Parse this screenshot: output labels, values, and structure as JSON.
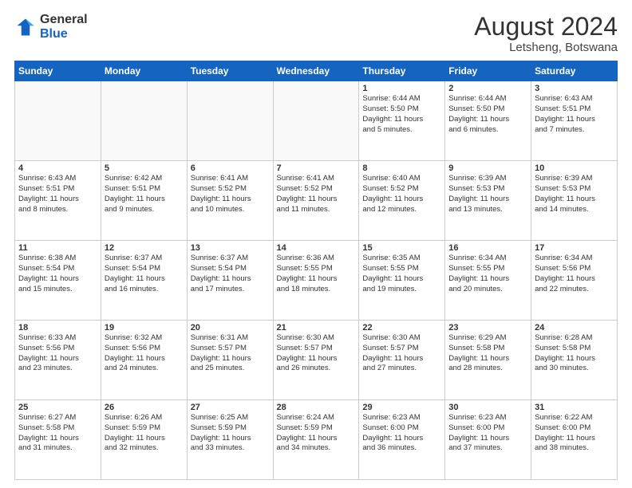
{
  "logo": {
    "general": "General",
    "blue": "Blue"
  },
  "header": {
    "month_year": "August 2024",
    "location": "Letsheng, Botswana"
  },
  "days_of_week": [
    "Sunday",
    "Monday",
    "Tuesday",
    "Wednesday",
    "Thursday",
    "Friday",
    "Saturday"
  ],
  "weeks": [
    [
      {
        "num": "",
        "detail": ""
      },
      {
        "num": "",
        "detail": ""
      },
      {
        "num": "",
        "detail": ""
      },
      {
        "num": "",
        "detail": ""
      },
      {
        "num": "1",
        "detail": "Sunrise: 6:44 AM\nSunset: 5:50 PM\nDaylight: 11 hours\nand 5 minutes."
      },
      {
        "num": "2",
        "detail": "Sunrise: 6:44 AM\nSunset: 5:50 PM\nDaylight: 11 hours\nand 6 minutes."
      },
      {
        "num": "3",
        "detail": "Sunrise: 6:43 AM\nSunset: 5:51 PM\nDaylight: 11 hours\nand 7 minutes."
      }
    ],
    [
      {
        "num": "4",
        "detail": "Sunrise: 6:43 AM\nSunset: 5:51 PM\nDaylight: 11 hours\nand 8 minutes."
      },
      {
        "num": "5",
        "detail": "Sunrise: 6:42 AM\nSunset: 5:51 PM\nDaylight: 11 hours\nand 9 minutes."
      },
      {
        "num": "6",
        "detail": "Sunrise: 6:41 AM\nSunset: 5:52 PM\nDaylight: 11 hours\nand 10 minutes."
      },
      {
        "num": "7",
        "detail": "Sunrise: 6:41 AM\nSunset: 5:52 PM\nDaylight: 11 hours\nand 11 minutes."
      },
      {
        "num": "8",
        "detail": "Sunrise: 6:40 AM\nSunset: 5:52 PM\nDaylight: 11 hours\nand 12 minutes."
      },
      {
        "num": "9",
        "detail": "Sunrise: 6:39 AM\nSunset: 5:53 PM\nDaylight: 11 hours\nand 13 minutes."
      },
      {
        "num": "10",
        "detail": "Sunrise: 6:39 AM\nSunset: 5:53 PM\nDaylight: 11 hours\nand 14 minutes."
      }
    ],
    [
      {
        "num": "11",
        "detail": "Sunrise: 6:38 AM\nSunset: 5:54 PM\nDaylight: 11 hours\nand 15 minutes."
      },
      {
        "num": "12",
        "detail": "Sunrise: 6:37 AM\nSunset: 5:54 PM\nDaylight: 11 hours\nand 16 minutes."
      },
      {
        "num": "13",
        "detail": "Sunrise: 6:37 AM\nSunset: 5:54 PM\nDaylight: 11 hours\nand 17 minutes."
      },
      {
        "num": "14",
        "detail": "Sunrise: 6:36 AM\nSunset: 5:55 PM\nDaylight: 11 hours\nand 18 minutes."
      },
      {
        "num": "15",
        "detail": "Sunrise: 6:35 AM\nSunset: 5:55 PM\nDaylight: 11 hours\nand 19 minutes."
      },
      {
        "num": "16",
        "detail": "Sunrise: 6:34 AM\nSunset: 5:55 PM\nDaylight: 11 hours\nand 20 minutes."
      },
      {
        "num": "17",
        "detail": "Sunrise: 6:34 AM\nSunset: 5:56 PM\nDaylight: 11 hours\nand 22 minutes."
      }
    ],
    [
      {
        "num": "18",
        "detail": "Sunrise: 6:33 AM\nSunset: 5:56 PM\nDaylight: 11 hours\nand 23 minutes."
      },
      {
        "num": "19",
        "detail": "Sunrise: 6:32 AM\nSunset: 5:56 PM\nDaylight: 11 hours\nand 24 minutes."
      },
      {
        "num": "20",
        "detail": "Sunrise: 6:31 AM\nSunset: 5:57 PM\nDaylight: 11 hours\nand 25 minutes."
      },
      {
        "num": "21",
        "detail": "Sunrise: 6:30 AM\nSunset: 5:57 PM\nDaylight: 11 hours\nand 26 minutes."
      },
      {
        "num": "22",
        "detail": "Sunrise: 6:30 AM\nSunset: 5:57 PM\nDaylight: 11 hours\nand 27 minutes."
      },
      {
        "num": "23",
        "detail": "Sunrise: 6:29 AM\nSunset: 5:58 PM\nDaylight: 11 hours\nand 28 minutes."
      },
      {
        "num": "24",
        "detail": "Sunrise: 6:28 AM\nSunset: 5:58 PM\nDaylight: 11 hours\nand 30 minutes."
      }
    ],
    [
      {
        "num": "25",
        "detail": "Sunrise: 6:27 AM\nSunset: 5:58 PM\nDaylight: 11 hours\nand 31 minutes."
      },
      {
        "num": "26",
        "detail": "Sunrise: 6:26 AM\nSunset: 5:59 PM\nDaylight: 11 hours\nand 32 minutes."
      },
      {
        "num": "27",
        "detail": "Sunrise: 6:25 AM\nSunset: 5:59 PM\nDaylight: 11 hours\nand 33 minutes."
      },
      {
        "num": "28",
        "detail": "Sunrise: 6:24 AM\nSunset: 5:59 PM\nDaylight: 11 hours\nand 34 minutes."
      },
      {
        "num": "29",
        "detail": "Sunrise: 6:23 AM\nSunset: 6:00 PM\nDaylight: 11 hours\nand 36 minutes."
      },
      {
        "num": "30",
        "detail": "Sunrise: 6:23 AM\nSunset: 6:00 PM\nDaylight: 11 hours\nand 37 minutes."
      },
      {
        "num": "31",
        "detail": "Sunrise: 6:22 AM\nSunset: 6:00 PM\nDaylight: 11 hours\nand 38 minutes."
      }
    ]
  ]
}
